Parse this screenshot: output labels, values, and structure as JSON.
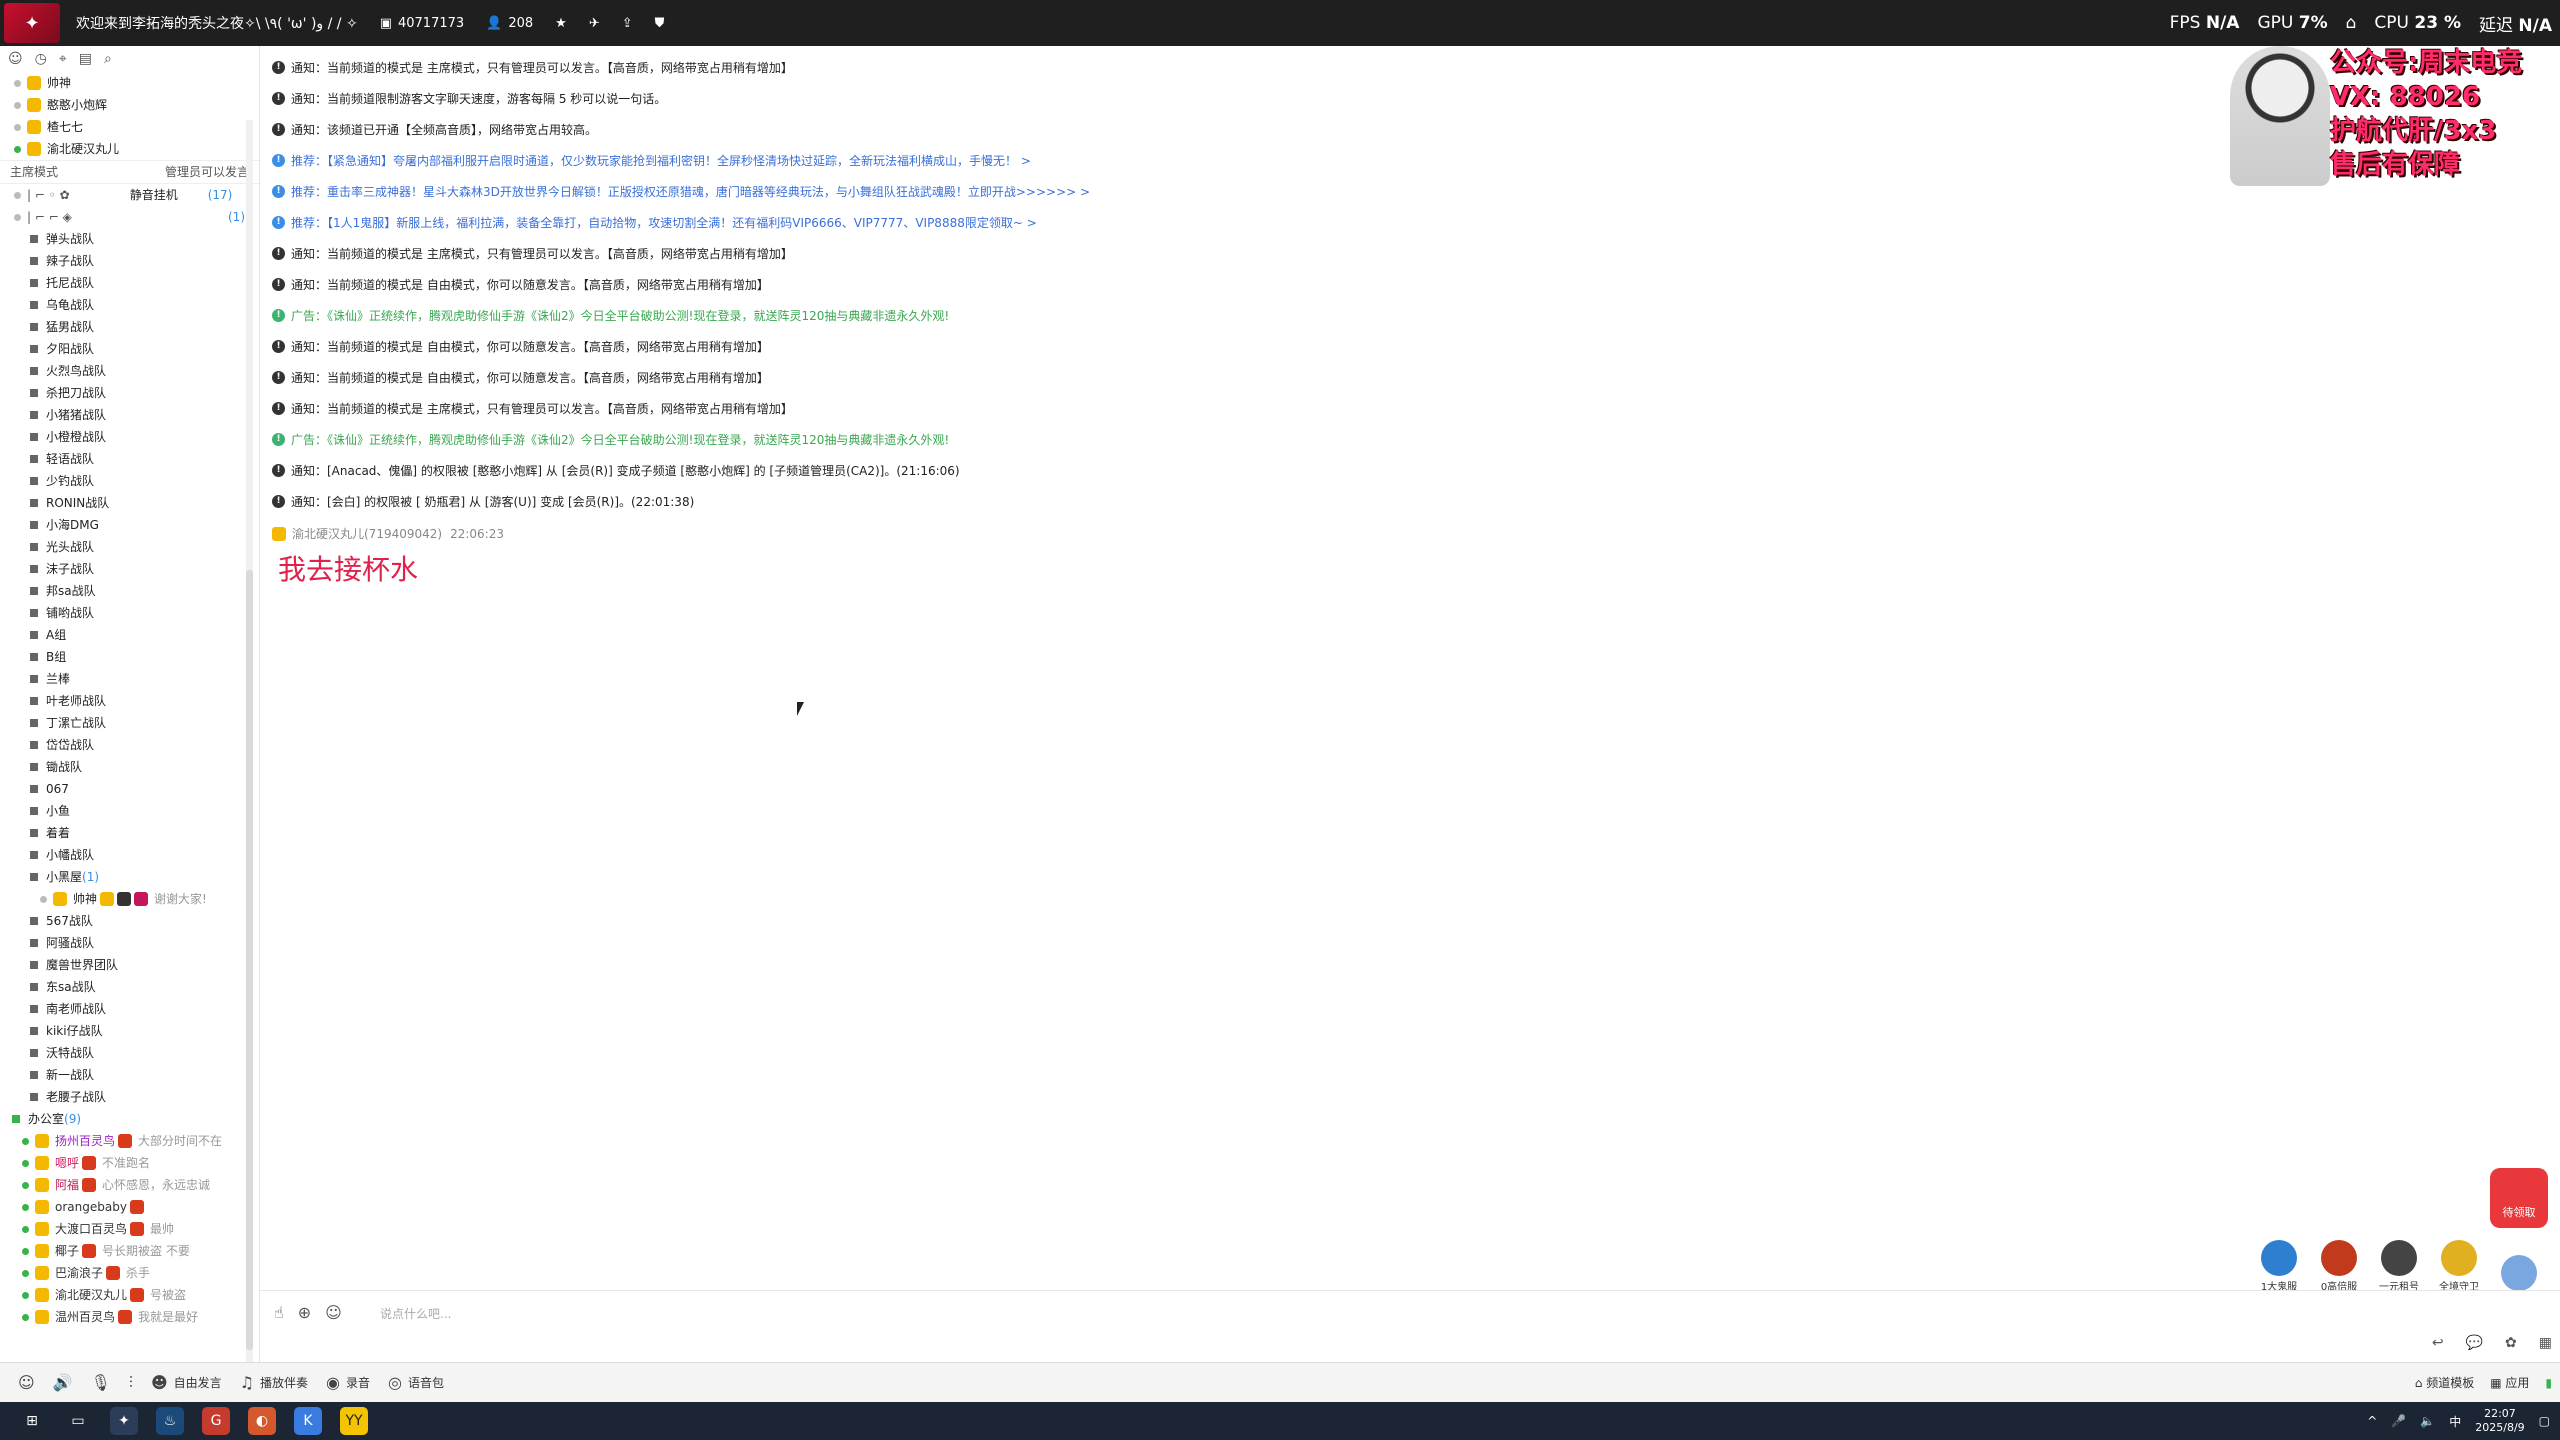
{
  "title": "欢迎来到李拓海的秃头之夜✧\\ \\٩( 'ω' )و / / ✧",
  "channel_id": "40717173",
  "online": "208",
  "stats": {
    "fps_label": "FPS",
    "fps": "N/A",
    "gpu_label": "GPU",
    "gpu": "7%",
    "cpu_label": "CPU",
    "cpu": "23 %",
    "lat_label": "延迟",
    "lat": "N/A"
  },
  "overlay": {
    "lines": [
      "公众号:周末电竞",
      "VX: 88026",
      "护航代肝/3x3",
      "售后有保障"
    ]
  },
  "sidebar": {
    "top_users": [
      "帅神",
      "憨憨小炮辉",
      "楂七七",
      "渝北硬汉丸儿"
    ],
    "mode": "主席模式",
    "mode_note": "管理员可以发言",
    "hang_label": "静音挂机",
    "hang_count": "(17)",
    "hang_count2": "(1)",
    "teams": [
      "弹头战队",
      "辣子战队",
      "托尼战队",
      "乌龟战队",
      "猛男战队",
      "夕阳战队",
      "火烈鸟战队",
      "杀把刀战队",
      "小猪猪战队",
      "小橙橙战队",
      "轻语战队",
      "少钓战队",
      "RONIN战队",
      "小海DMG",
      "光头战队",
      "沫子战队",
      "邦sa战队",
      "铺哟战队",
      "A组",
      "B组",
      "兰棒",
      "叶老师战队",
      "丁漯亡战队",
      "岱岱战队",
      "锄战队",
      "067",
      "小鱼",
      "着着",
      "小幡战队",
      "小黑屋"
    ],
    "blackroom_count": "(1)",
    "blackroom_user": "帅神",
    "blackroom_user_sig": "谢谢大家!",
    "teams2": [
      "567战队",
      "阿骚战队",
      "魔兽世界团队",
      "东sa战队",
      "南老师战队",
      "kiki仔战队",
      "沃特战队",
      "新一战队",
      "老腰子战队"
    ],
    "office": "办公室",
    "office_count": "(9)",
    "office_users": [
      {
        "name": "扬州百灵鸟",
        "sig": "大部分时间不在"
      },
      {
        "name": "嗯呼",
        "sig": "不准跑名"
      },
      {
        "name": "阿福",
        "sig": "心怀感恩，永远忠诚"
      },
      {
        "name": "orangebaby",
        "sig": ""
      },
      {
        "name": "大渡口百灵鸟",
        "sig": "最帅"
      },
      {
        "name": "椰子",
        "sig": "号长期被盗 不要"
      },
      {
        "name": "巴渝浪子",
        "sig": "杀手"
      },
      {
        "name": "渝北硬汉丸儿",
        "sig": "号被盗"
      },
      {
        "name": "温州百灵鸟",
        "sig": "我就是最好"
      }
    ]
  },
  "messages": [
    {
      "type": "notice",
      "text": "通知：当前频道的模式是 主席模式，只有管理员可以发言。【高音质，网络带宽占用稍有增加】"
    },
    {
      "type": "notice",
      "text": "通知：当前频道限制游客文字聊天速度，游客每隔 5 秒可以说一句话。"
    },
    {
      "type": "notice",
      "text": "通知：该频道已开通【全频高音质】，网络带宽占用较高。"
    },
    {
      "type": "rec",
      "text": "推荐：【紧急通知】夸屠内部福利服开启限时通道，仅少数玩家能抢到福利密钥！全屏秒怪清场快过延踪，全新玩法福利横成山，手慢无！ >"
    },
    {
      "type": "rec",
      "text": "推荐：重击率三成神器！星斗大森林3D开放世界今日解锁！正版授权还原猎魂，唐门暗器等经典玩法，与小舞组队狂战武魂殿！立即开战>>>>>> >"
    },
    {
      "type": "rec",
      "text": "推荐：【1人1鬼服】新服上线，福利拉满，装备全靠打，自动拾物，攻速切割全满！还有福利码VIP6666、VIP7777、VIP8888限定领取~ >"
    },
    {
      "type": "notice",
      "text": "通知：当前频道的模式是 主席模式，只有管理员可以发言。【高音质，网络带宽占用稍有增加】"
    },
    {
      "type": "notice",
      "text": "通知：当前频道的模式是 自由模式，你可以随意发言。【高音质，网络带宽占用稍有增加】"
    },
    {
      "type": "ad",
      "text": "广告：《诛仙》正统续作，腾观虎助修仙手游《诛仙2》今日全平台破助公测!现在登录，就送阵灵120抽与典藏非遗永久外观!"
    },
    {
      "type": "notice",
      "text": "通知：当前频道的模式是 自由模式，你可以随意发言。【高音质，网络带宽占用稍有增加】"
    },
    {
      "type": "notice",
      "text": "通知：当前频道的模式是 自由模式，你可以随意发言。【高音质，网络带宽占用稍有增加】"
    },
    {
      "type": "notice",
      "text": "通知：当前频道的模式是 主席模式，只有管理员可以发言。【高音质，网络带宽占用稍有增加】"
    },
    {
      "type": "ad",
      "text": "广告：《诛仙》正统续作，腾观虎助修仙手游《诛仙2》今日全平台破助公测!现在登录，就送阵灵120抽与典藏非遗永久外观!"
    },
    {
      "type": "notice",
      "text": "通知：[Anacad、傀儡] 的权限被 [憨憨小炮辉] 从 [会员(R)] 变成子频道 [憨憨小炮辉] 的 [子频道管理员(CA2)]。(21:16:06)"
    },
    {
      "type": "notice",
      "text": "通知：[会白] 的权限被 [ 奶瓶君] 从 [游客(U)] 变成 [会员(R)]。(22:01:38)"
    }
  ],
  "chat_sender": "渝北硬汉丸儿(719409042)",
  "chat_time": "22:06:23",
  "chat_text": "我去接杯水",
  "input_placeholder": "说点什么吧...",
  "gifts": [
    {
      "label": "1大鬼服"
    },
    {
      "label": "0高倍服"
    },
    {
      "label": "一元租号"
    },
    {
      "label": "全境守卫"
    },
    {
      "label": ""
    }
  ],
  "treasure": "待领取",
  "bottom": {
    "free": "自由发言",
    "music": "播放伴奏",
    "record": "录音",
    "voice": "语音包",
    "template": "频道模板",
    "apps": "应用"
  },
  "clock": {
    "time": "22:07",
    "date": "2025/8/9"
  },
  "ime": "中"
}
